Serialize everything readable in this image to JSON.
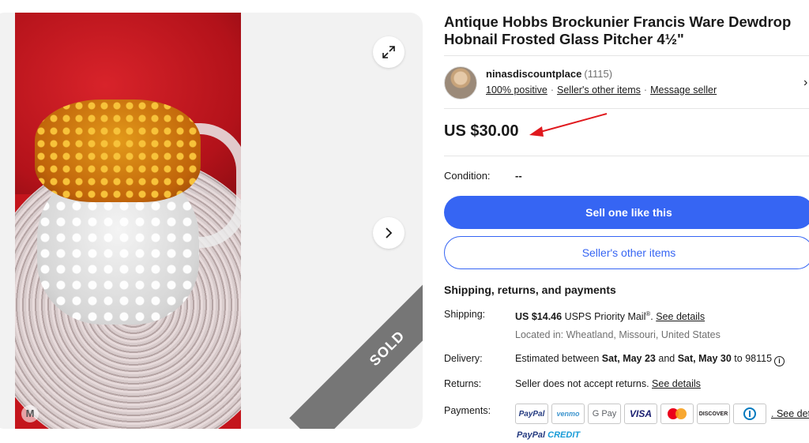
{
  "gallery": {
    "sold_label": "SOLD",
    "watermark": "M"
  },
  "listing": {
    "title": "Antique Hobbs Brockunier Francis Ware Dewdrop Hobnail Frosted Glass Pitcher 4½\"",
    "price": "US $30.00"
  },
  "seller": {
    "name": "ninasdiscountplace",
    "feedback_count": "(1115)",
    "positive": "100% positive",
    "other_items": "Seller's other items",
    "message": "Message seller",
    "separator": "·",
    "chevron": "›"
  },
  "condition": {
    "label": "Condition:",
    "value": "--"
  },
  "buttons": {
    "sell_like": "Sell one like this",
    "seller_other_items": "Seller's other items"
  },
  "shipping": {
    "heading": "Shipping, returns, and payments",
    "shipping_label": "Shipping:",
    "shipping_price": "US $14.46",
    "shipping_method": "USPS Priority Mail",
    "shipping_reg": "®",
    "period": ".",
    "see_details": "See details",
    "location": "Located in: Wheatland, Missouri, United States",
    "delivery_label": "Delivery:",
    "delivery_prefix": "Estimated between",
    "delivery_start": "Sat, May 23",
    "delivery_and": "and",
    "delivery_end": "Sat, May 30",
    "delivery_to": "to 98115",
    "info_icon": "i",
    "returns_label": "Returns:",
    "returns_text": "Seller does not accept returns.",
    "returns_see": "See details",
    "payments_label": "Payments:",
    "payments_see": ". See details"
  },
  "payments": {
    "paypal": "PayPal",
    "venmo": "venmo",
    "gpay": "G Pay",
    "visa": "VISA",
    "discover": "DISCOVER",
    "paypal_credit_a": "PayPal",
    "paypal_credit_b": "CREDIT"
  },
  "colors": {
    "primary": "#3665f3",
    "sold_ribbon": "#767676",
    "arrow": "#e0191e"
  }
}
